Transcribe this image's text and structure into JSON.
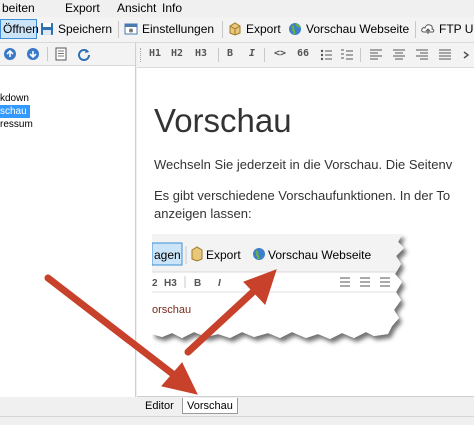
{
  "menu": {
    "items": [
      "beiten",
      "Export",
      "Ansicht",
      "Info"
    ]
  },
  "toolbar": {
    "open_label": "Öffnen",
    "save_label": "Speichern",
    "settings_label": "Einstellungen",
    "export_label": "Export",
    "preview_web_label": "Vorschau Webseite",
    "ftp_label": "FTP Up"
  },
  "format_toolbar": {
    "buttons": [
      "H1",
      "H2",
      "H3",
      "B",
      "I",
      "<>",
      "66"
    ]
  },
  "tree": {
    "items": [
      "kdown",
      "schau",
      "ressum"
    ],
    "selected_index": 1
  },
  "preview": {
    "title": "Vorschau",
    "paragraph1": "Wechseln Sie jederzeit in die Vorschau. Die Seitenv",
    "paragraph2_line1": "Es gibt verschiedene Vorschaufunktionen. In der To",
    "paragraph2_line2": "anzeigen lassen:"
  },
  "screenshot_inset": {
    "tab_label": "agen",
    "export_label": "Export",
    "preview_web_label": "Vorschau Webseite",
    "fmt_labels": [
      "2",
      "H3",
      "B",
      "I"
    ],
    "code_text": "orschau"
  },
  "tabs": {
    "editor_label": "Editor",
    "preview_label": "Vorschau"
  },
  "colors": {
    "arrow": "#c8412a",
    "selection": "#3399ff",
    "active_button_border": "#3c8fd8"
  }
}
